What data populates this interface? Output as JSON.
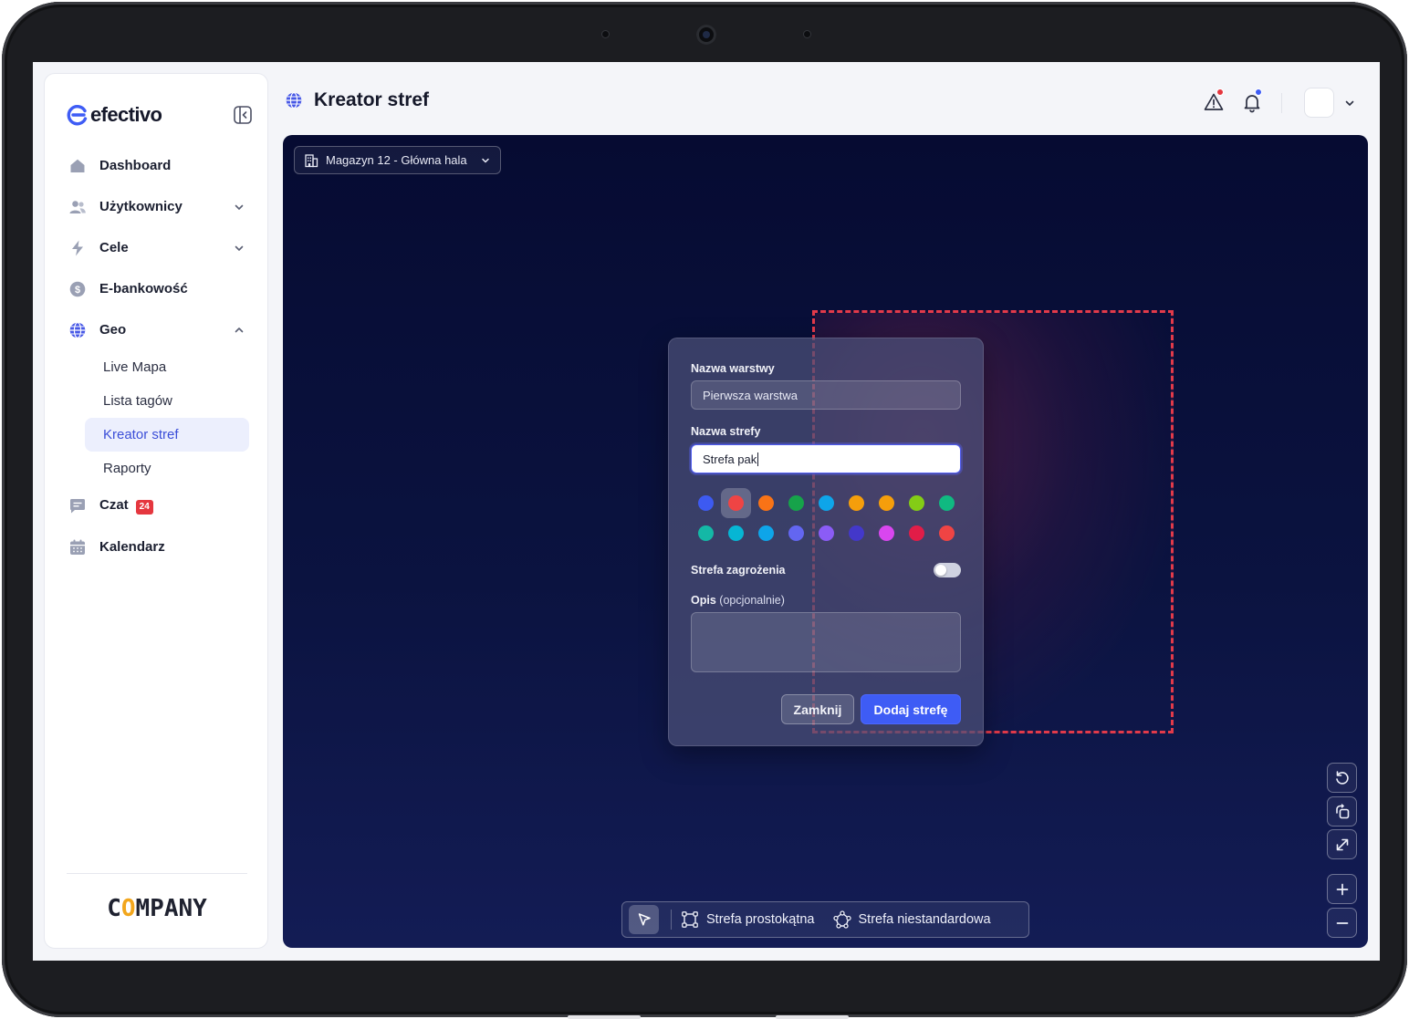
{
  "app": {
    "brand": "efectivo",
    "company_logo": "COMPANY"
  },
  "header": {
    "title": "Kreator stref"
  },
  "sidebar": {
    "items": [
      {
        "label": "Dashboard"
      },
      {
        "label": "Użytkownicy"
      },
      {
        "label": "Cele"
      },
      {
        "label": "E-bankowość"
      },
      {
        "label": "Geo"
      },
      {
        "label": "Czat",
        "badge": "24"
      },
      {
        "label": "Kalendarz"
      }
    ],
    "geo_sub": [
      {
        "label": "Live Mapa"
      },
      {
        "label": "Lista tagów"
      },
      {
        "label": "Kreator stref",
        "active": true
      },
      {
        "label": "Raporty"
      }
    ]
  },
  "canvas": {
    "warehouse": "Magazyn 12 - Główna hala"
  },
  "dialog": {
    "layer_label": "Nazwa warstwy",
    "layer_value": "Pierwsza warstwa",
    "zone_label": "Nazwa strefy",
    "zone_value": "Strefa pak",
    "colors_row1": [
      "#3d5af1",
      "#ef4444",
      "#f97316",
      "#16a34a",
      "#0ea5e9",
      "#f59e0b",
      "#f59e0b",
      "#84cc16",
      "#10b981"
    ],
    "colors_row2": [
      "#14b8a6",
      "#06b6d4",
      "#0ea5e9",
      "#6366f1",
      "#8b5cf6",
      "#4338ca",
      "#d946ef",
      "#e11d48",
      "#ef4444"
    ],
    "selected_color": "#ef4444",
    "danger_label": "Strefa zagrożenia",
    "danger_enabled": false,
    "desc_label": "Opis",
    "desc_optional": "(opcjonalnie)",
    "close_label": "Zamknij",
    "add_label": "Dodaj strefę"
  },
  "toolbar": {
    "rect_label": "Strefa prostokątna",
    "custom_label": "Strefa niestandardowa"
  },
  "colors": {
    "accent": "#3e5cf5",
    "zone_border": "#e23a4a",
    "alert_dot": "#e5373f",
    "notif_dot": "#3e5cf5"
  }
}
